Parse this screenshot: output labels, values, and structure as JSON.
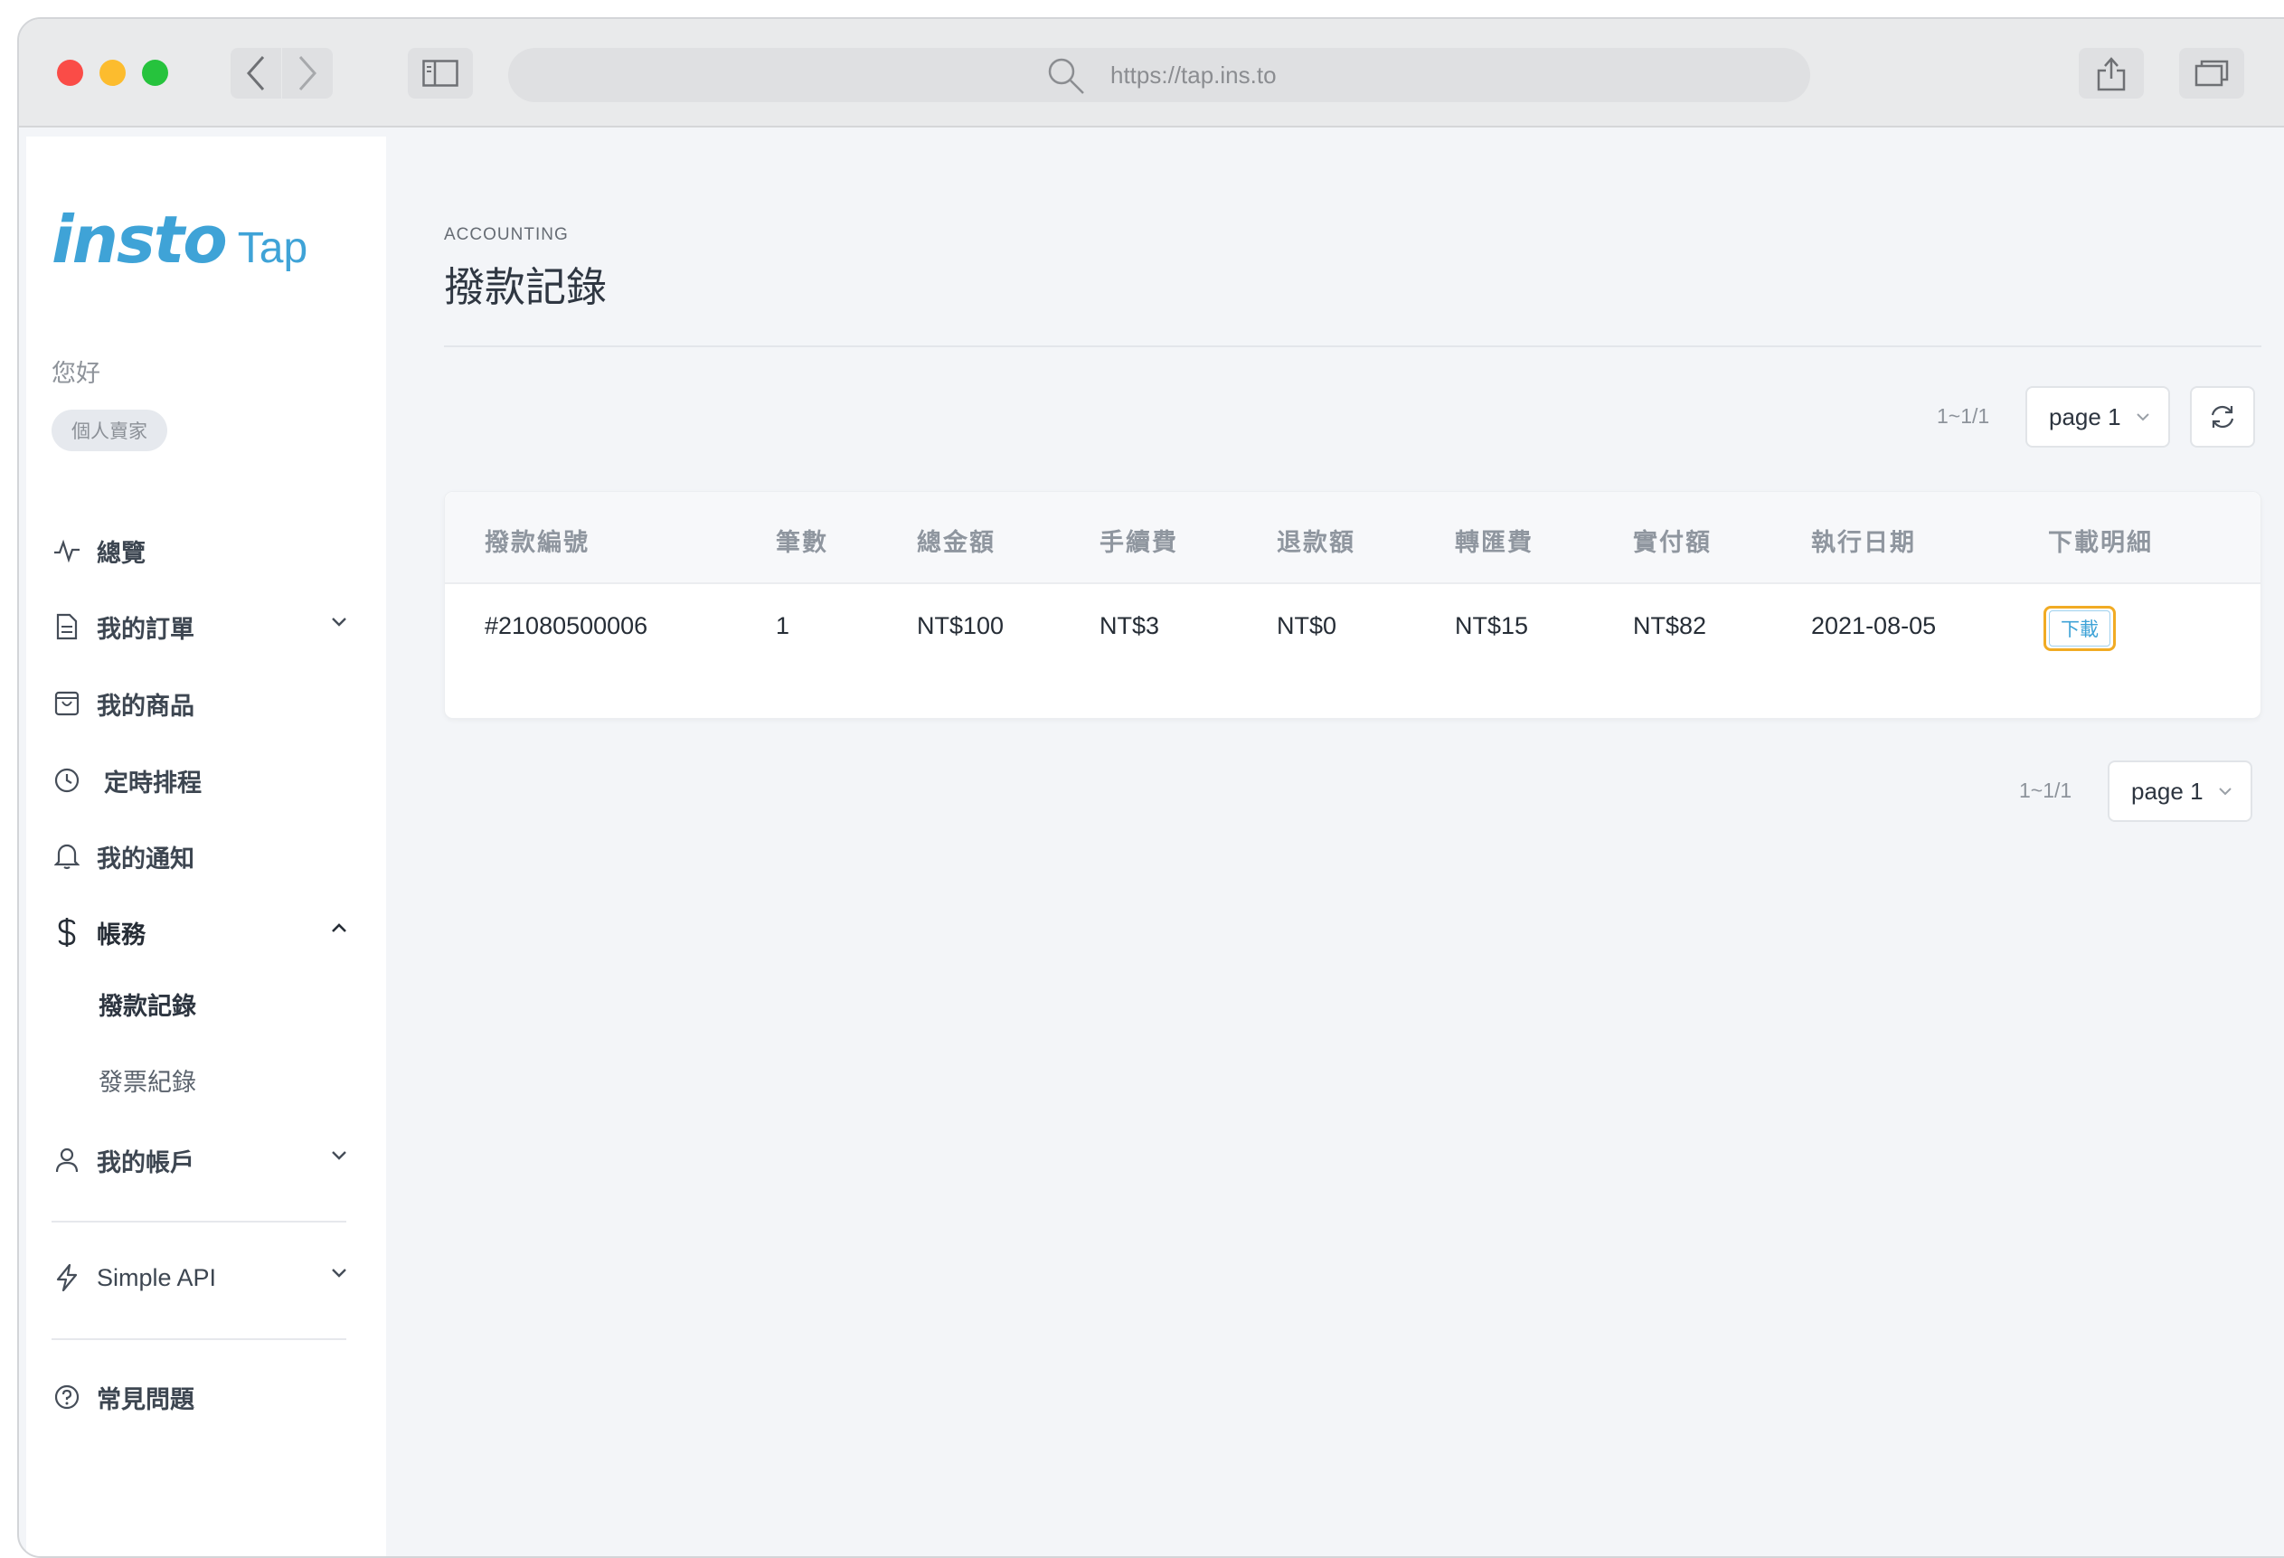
{
  "browser": {
    "url": "https://tap.ins.to"
  },
  "brand": {
    "logo_main": "insto",
    "logo_sub": "Tap",
    "accent_color": "#3fa3d7"
  },
  "user": {
    "greeting": "您好",
    "role_badge": "個人賣家"
  },
  "sidebar": {
    "items": [
      {
        "label": "總覽",
        "icon": "activity-icon"
      },
      {
        "label": "我的訂單",
        "icon": "document-icon",
        "expandable": true
      },
      {
        "label": "我的商品",
        "icon": "shopping-bag-icon"
      },
      {
        "label": "定時排程",
        "icon": "clock-icon"
      },
      {
        "label": "我的通知",
        "icon": "bell-icon"
      },
      {
        "label": "帳務",
        "icon": "dollar-icon",
        "expanded": true
      },
      {
        "label": "我的帳戶",
        "icon": "user-icon",
        "expandable": true
      },
      {
        "label": "Simple API",
        "icon": "lightning-icon",
        "expandable": true
      },
      {
        "label": "常見問題",
        "icon": "help-circle-icon"
      }
    ],
    "accounting_sub": [
      {
        "label": "撥款記錄",
        "active": true
      },
      {
        "label": "發票紀錄",
        "active": false
      }
    ]
  },
  "header": {
    "eyebrow": "ACCOUNTING",
    "title": "撥款記錄"
  },
  "pagination": {
    "range": "1~1/1",
    "page_label": "page 1"
  },
  "table": {
    "columns": [
      "撥款編號",
      "筆數",
      "總金額",
      "手續費",
      "退款額",
      "轉匯費",
      "實付額",
      "執行日期",
      "下載明細"
    ],
    "rows": [
      {
        "id": "#21080500006",
        "count": "1",
        "total": "NT$100",
        "fee": "NT$3",
        "refund": "NT$0",
        "transfer_fee": "NT$15",
        "paid": "NT$82",
        "date": "2021-08-05",
        "download_label": "下載"
      }
    ]
  }
}
